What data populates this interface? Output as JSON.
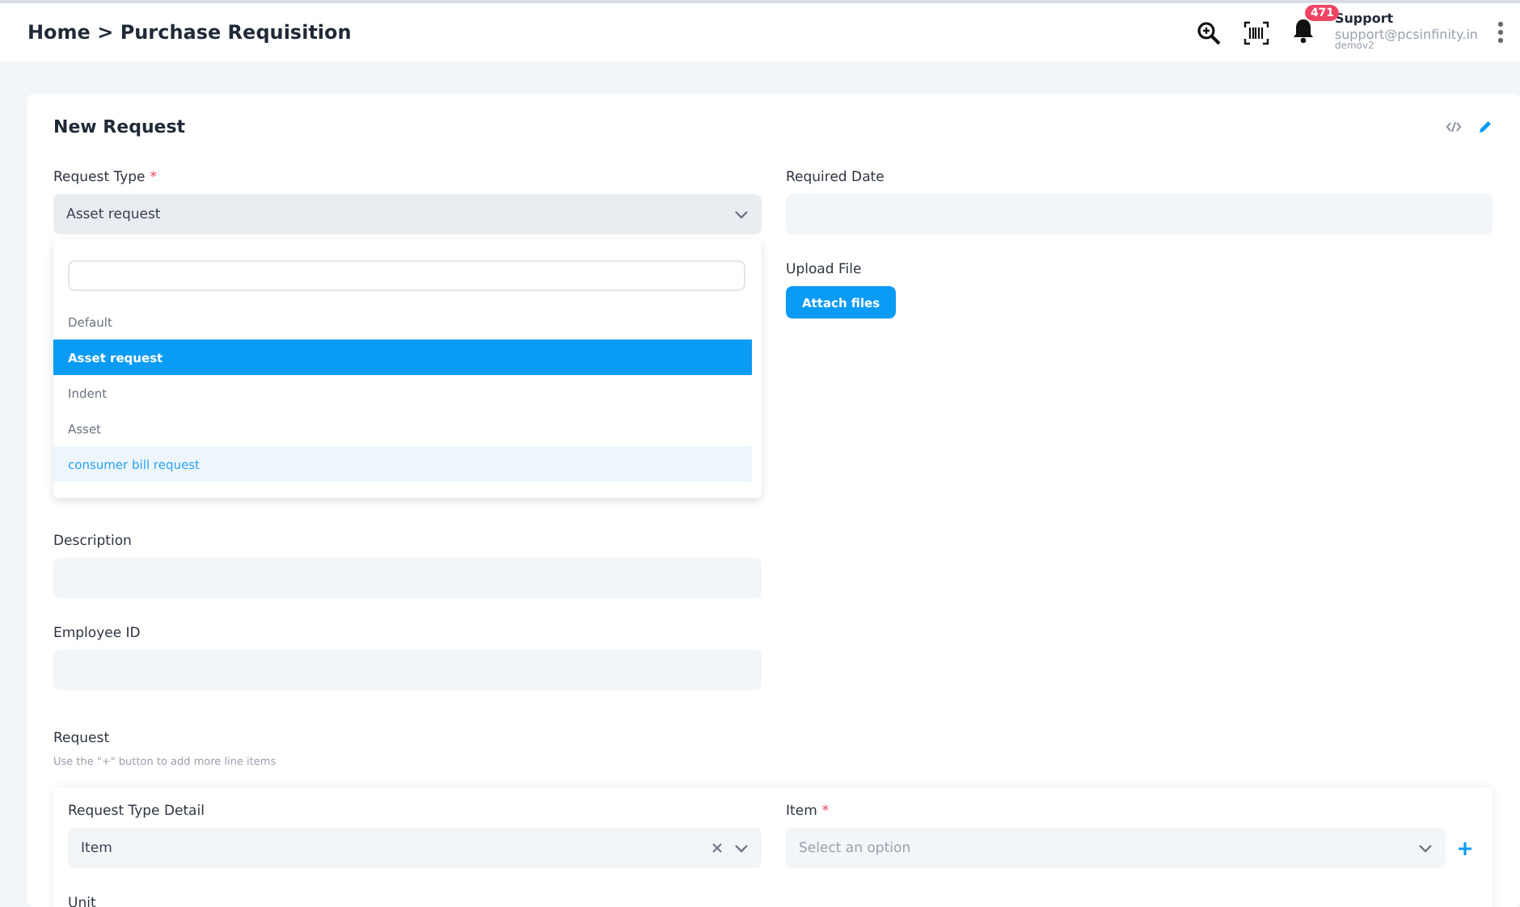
{
  "header": {
    "breadcrumb": "Home > Purchase Requisition",
    "notification_count": "471",
    "user": {
      "name": "Support",
      "email": "support@pcsinfinity.in",
      "tenant": "demov2"
    }
  },
  "form": {
    "title": "New Request",
    "request_type": {
      "label": "Request Type",
      "required_mark": "*",
      "value": "Asset request",
      "options": [
        {
          "label": "Default",
          "selected": false,
          "highlighted": false
        },
        {
          "label": "Asset request",
          "selected": true,
          "highlighted": false
        },
        {
          "label": "Indent",
          "selected": false,
          "highlighted": false
        },
        {
          "label": "Asset",
          "selected": false,
          "highlighted": false
        },
        {
          "label": "consumer bill request",
          "selected": false,
          "highlighted": true
        }
      ]
    },
    "required_date": {
      "label": "Required Date"
    },
    "upload": {
      "label": "Upload File",
      "button": "Attach files"
    },
    "description": {
      "label": "Description"
    },
    "employee_id": {
      "label": "Employee ID"
    },
    "request": {
      "title": "Request",
      "hint": "Use the \"+\" button to add more line items",
      "request_type_detail": {
        "label": "Request Type Detail",
        "value": "Item"
      },
      "item": {
        "label": "Item",
        "required_mark": "*",
        "placeholder": "Select an option"
      },
      "unit": {
        "label": "Unit"
      }
    }
  }
}
